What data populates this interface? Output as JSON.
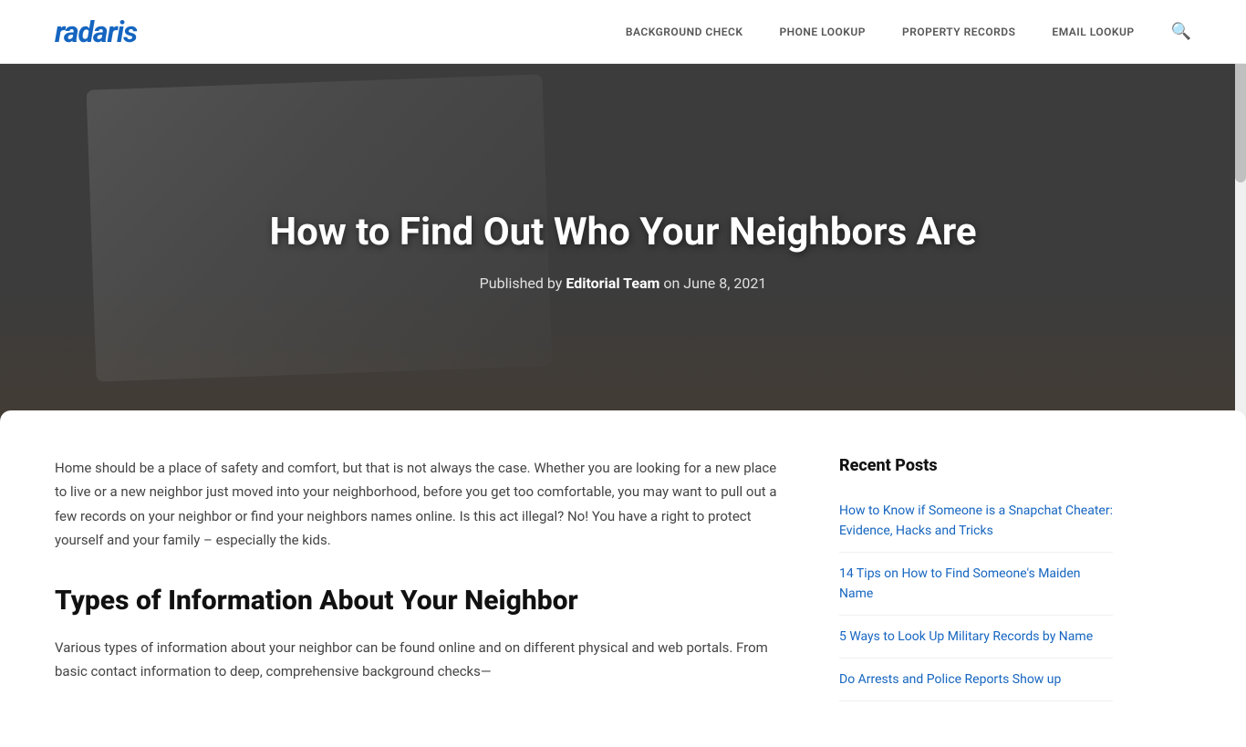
{
  "header": {
    "logo": "radaris",
    "nav": [
      {
        "id": "background-check",
        "label": "BACKGROUND CHECK"
      },
      {
        "id": "phone-lookup",
        "label": "PHONE LOOKUP"
      },
      {
        "id": "property-records",
        "label": "PROPERTY RECORDS"
      },
      {
        "id": "email-lookup",
        "label": "EMAIL LOOKUP"
      }
    ],
    "search_aria": "Search"
  },
  "hero": {
    "title": "How to Find Out Who Your Neighbors Are",
    "meta_prefix": "Published by ",
    "meta_author": "Editorial Team",
    "meta_date_prefix": " on ",
    "meta_date": "June 8, 2021"
  },
  "article": {
    "intro": "Home should be a place of safety and comfort, but that is not always the case. Whether you are looking for a new place to live or a new neighbor just moved into your neighborhood, before you get too comfortable, you may want to pull out a few records on your neighbor or find your neighbors names online. Is this act illegal? No! You have a right to protect yourself and your family – especially the kids.",
    "section_title": "Types of Information About Your Neighbor",
    "body": "Various types of information about your neighbor can be found online and on different physical and web portals. From basic contact information to deep, comprehensive background checks—"
  },
  "sidebar": {
    "section_title": "Recent Posts",
    "posts": [
      {
        "id": "snapchat",
        "label": "How to Know if Someone is a Snapchat Cheater: Evidence, Hacks and Tricks"
      },
      {
        "id": "maiden-name",
        "label": "14 Tips on How to Find Someone's Maiden Name"
      },
      {
        "id": "military",
        "label": "5 Ways to Look Up Military Records by Name"
      },
      {
        "id": "arrests",
        "label": "Do Arrests and Police Reports Show up"
      }
    ]
  }
}
